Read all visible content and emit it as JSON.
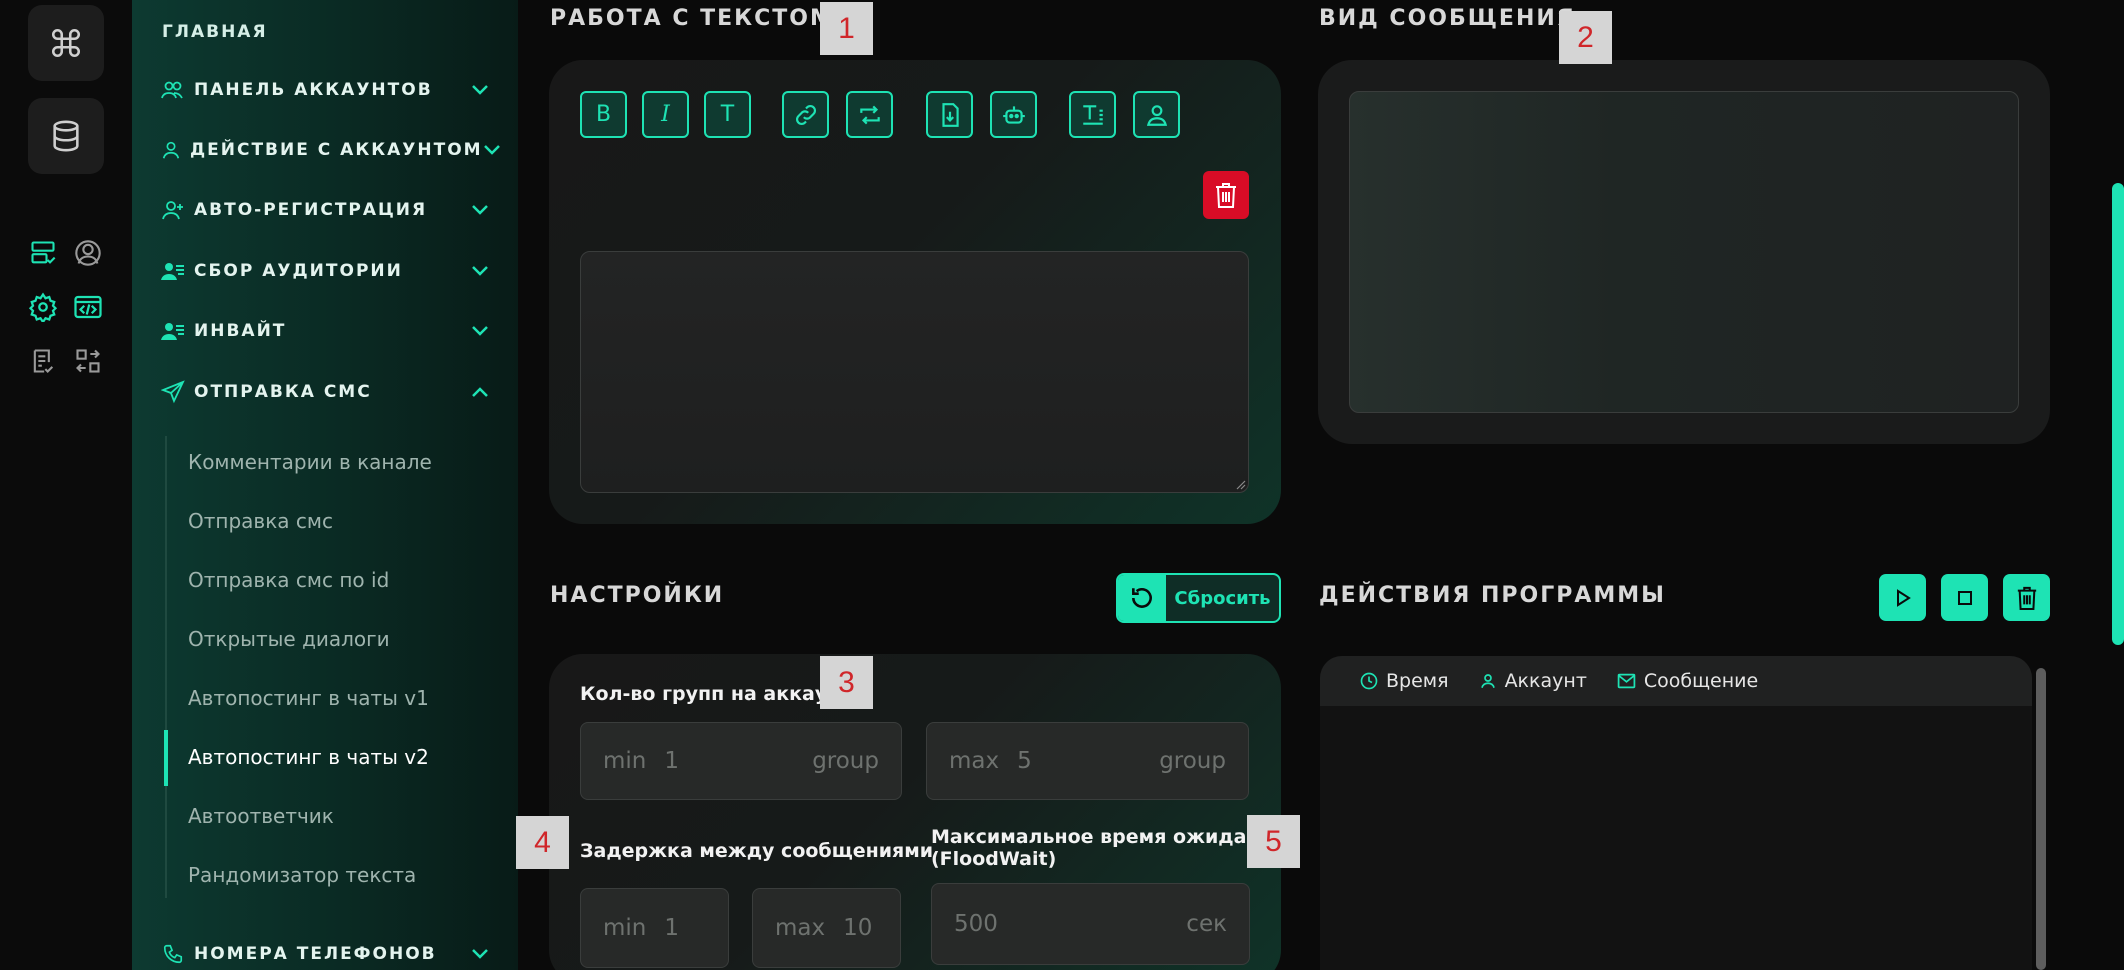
{
  "menu": {
    "home": "ГЛАВНАЯ",
    "items": [
      {
        "label": "ПАНЕЛЬ АККАУНТОВ",
        "icon": "users-icon",
        "expanded": false
      },
      {
        "label": "ДЕЙСТВИЕ С АККАУНТОМ",
        "icon": "user-icon",
        "expanded": false
      },
      {
        "label": "АВТО-РЕГИСТРАЦИЯ",
        "icon": "user-plus-icon",
        "expanded": false
      },
      {
        "label": "СБОР АУДИТОРИИ",
        "icon": "user-list-icon",
        "expanded": false
      },
      {
        "label": "ИНВАЙТ",
        "icon": "user-list-icon",
        "expanded": false
      },
      {
        "label": "ОТПРАВКА СМС",
        "icon": "send-icon",
        "expanded": true
      },
      {
        "label": "НОМЕРА ТЕЛЕФОНОВ",
        "icon": "phone-icon",
        "expanded": false
      }
    ],
    "subitems": [
      "Комментарии в канале",
      "Отправка смс",
      "Отправка смс по id",
      "Открытые диалоги",
      "Автопостинг в чаты v1",
      "Автопостинг в чаты v2",
      "Автоответчик",
      "Рандомизатор текста"
    ],
    "active_subitem": "Автопостинг в чаты v2"
  },
  "text_panel": {
    "title": "РАБОТА С ТЕКСТОМ",
    "toolbar": [
      "bold",
      "italic",
      "text",
      "link",
      "repost",
      "file-download",
      "bot",
      "text-format",
      "user"
    ],
    "bold_glyph": "B",
    "italic_glyph": "I",
    "text_glyph": "T"
  },
  "preview_panel": {
    "title": "ВИД СООБЩЕНИЯ"
  },
  "settings": {
    "title": "НАСТРОЙКИ",
    "reset_label": "Сбросить",
    "groups_label": "Кол-во групп на аккаунт",
    "groups_min": {
      "prefix": "min",
      "value": "1",
      "unit": "group"
    },
    "groups_max": {
      "prefix": "max",
      "value": "5",
      "unit": "group"
    },
    "delay_label": "Задержка между сообщениями",
    "delay_min": {
      "prefix": "min",
      "value": "1"
    },
    "delay_max": {
      "prefix": "max",
      "value": "10"
    },
    "floodwait_label_1": "Максимальное время ожидания",
    "floodwait_label_2": "(FloodWait)",
    "floodwait": {
      "value": "500",
      "unit": "сек"
    }
  },
  "actions": {
    "title": "ДЕЙСТВИЯ ПРОГРАММЫ",
    "columns": [
      "Время",
      "Аккаунт",
      "Сообщение"
    ]
  },
  "badges": [
    "1",
    "2",
    "3",
    "4",
    "5"
  ],
  "colors": {
    "accent": "#1ee3b4",
    "danger": "#d80c26",
    "badge_text": "#d0262a"
  }
}
